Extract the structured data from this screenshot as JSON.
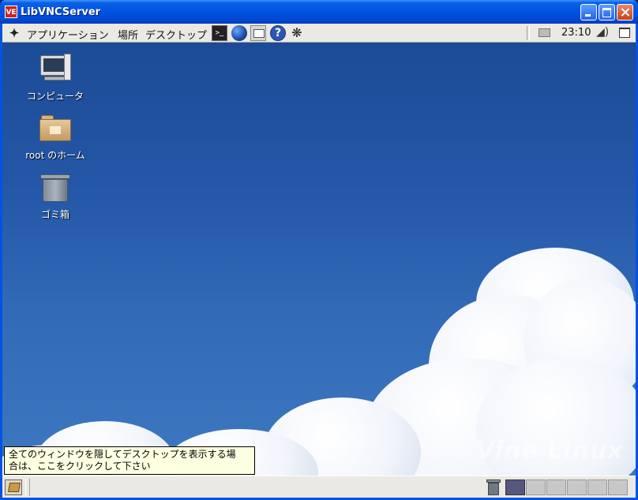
{
  "window": {
    "title": "LibVNCServer",
    "app_icon_text": "VE",
    "buttons": [
      "minimize-icon",
      "maximize-icon",
      "close-icon"
    ]
  },
  "top_panel": {
    "menus": [
      "アプリケーション",
      "場所",
      "デスクトップ"
    ],
    "launchers": [
      "terminal-icon",
      "web-browser-icon",
      "mail-icon",
      "help-icon",
      "bug-report-icon"
    ],
    "clock": "23:10",
    "tray": [
      "printer-icon",
      "volume-icon",
      "show-desktop-icon"
    ]
  },
  "desktop": {
    "icons": [
      {
        "label": "コンピュータ",
        "icon": "computer-icon"
      },
      {
        "label": "root のホーム",
        "icon": "home-folder-icon"
      },
      {
        "label": "ゴミ箱",
        "icon": "trash-icon"
      }
    ],
    "watermark": "Vine Linux",
    "background": "sky-with-clouds"
  },
  "tooltip": {
    "line1": "全てのウィンドウを隠してデスクトップを表示する場",
    "line2": "合は、ここをクリックして下さい"
  },
  "bottom_panel": {
    "workspaces": 6,
    "active_workspace": 1
  },
  "colors": {
    "title_bar": "#0054e3",
    "panel": "#ebe9e4",
    "desktop_sky": "#2458a8",
    "tooltip_bg": "#ffffe1",
    "active_workspace": "#56577e"
  }
}
